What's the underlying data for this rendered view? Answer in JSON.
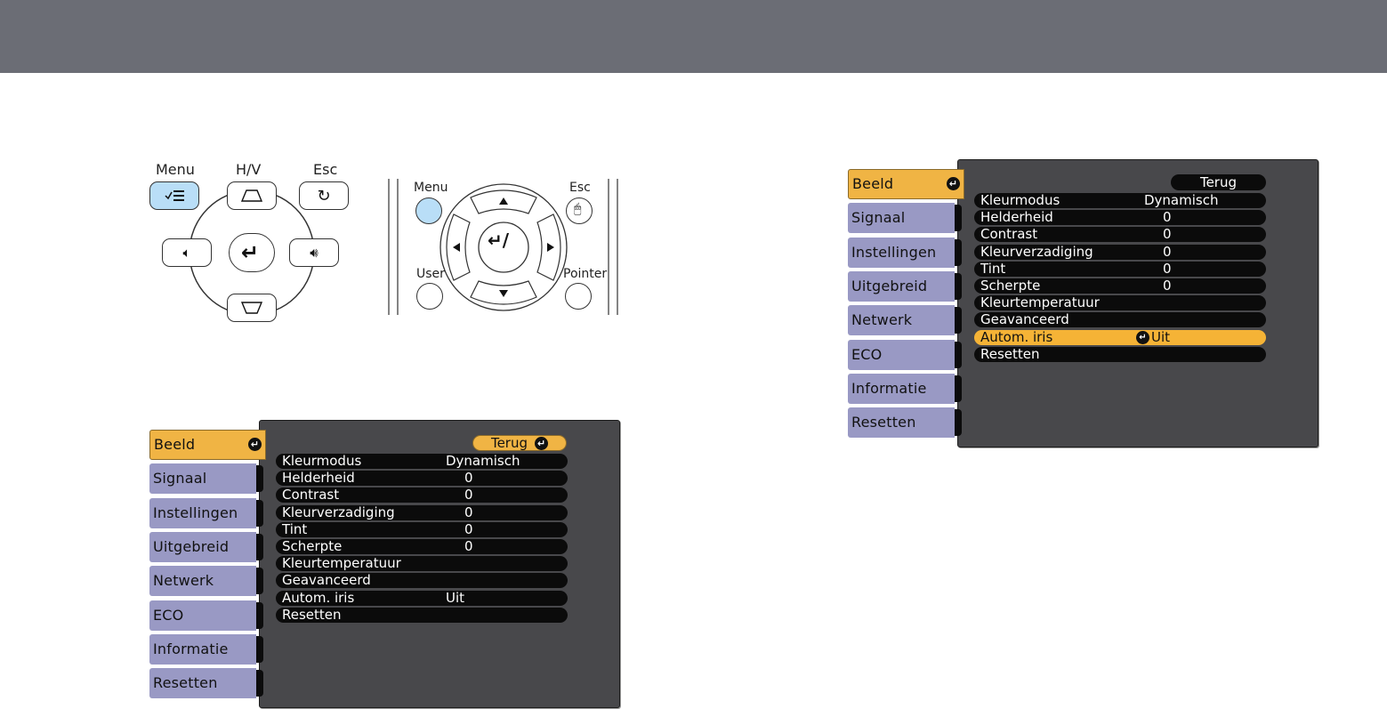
{
  "control_panel": {
    "menu_label": "Menu",
    "hv_label": "H/V",
    "esc_label": "Esc"
  },
  "remote": {
    "menu_label": "Menu",
    "esc_label": "Esc",
    "user_label": "User",
    "pointer_label": "Pointer"
  },
  "menu_screens": [
    {
      "tabs": [
        "Beeld",
        "Signaal",
        "Instellingen",
        "Uitgebreid",
        "Netwerk",
        "ECO",
        "Informatie",
        "Resetten"
      ],
      "back_label": "Terug",
      "rows": [
        {
          "label": "Kleurmodus",
          "value": "Dynamisch"
        },
        {
          "label": "Helderheid",
          "value": "0"
        },
        {
          "label": "Contrast",
          "value": "0"
        },
        {
          "label": "Kleurverzadiging",
          "value": "0"
        },
        {
          "label": "Tint",
          "value": "0"
        },
        {
          "label": "Scherpte",
          "value": "0"
        },
        {
          "label": "Kleurtemperatuur",
          "value": ""
        },
        {
          "label": "Geavanceerd",
          "value": ""
        },
        {
          "label": "Autom. iris",
          "value": "Uit"
        },
        {
          "label": "Resetten",
          "value": ""
        }
      ]
    },
    {
      "tabs": [
        "Beeld",
        "Signaal",
        "Instellingen",
        "Uitgebreid",
        "Netwerk",
        "ECO",
        "Informatie",
        "Resetten"
      ],
      "back_label": "Terug",
      "rows": [
        {
          "label": "Kleurmodus",
          "value": "Dynamisch"
        },
        {
          "label": "Helderheid",
          "value": "0"
        },
        {
          "label": "Contrast",
          "value": "0"
        },
        {
          "label": "Kleurverzadiging",
          "value": "0"
        },
        {
          "label": "Tint",
          "value": "0"
        },
        {
          "label": "Scherpte",
          "value": "0"
        },
        {
          "label": "Kleurtemperatuur",
          "value": ""
        },
        {
          "label": "Geavanceerd",
          "value": ""
        },
        {
          "label": "Autom. iris",
          "value": "Uit"
        },
        {
          "label": "Resetten",
          "value": ""
        }
      ]
    }
  ],
  "colors": {
    "header_bar": "#6b6d75",
    "menu_button_highlight": "#b9def7",
    "active_tab": "#f0b444",
    "inactive_tab": "#9999c4",
    "menu_background": "#48484b",
    "selected_row": "#f5b336"
  }
}
